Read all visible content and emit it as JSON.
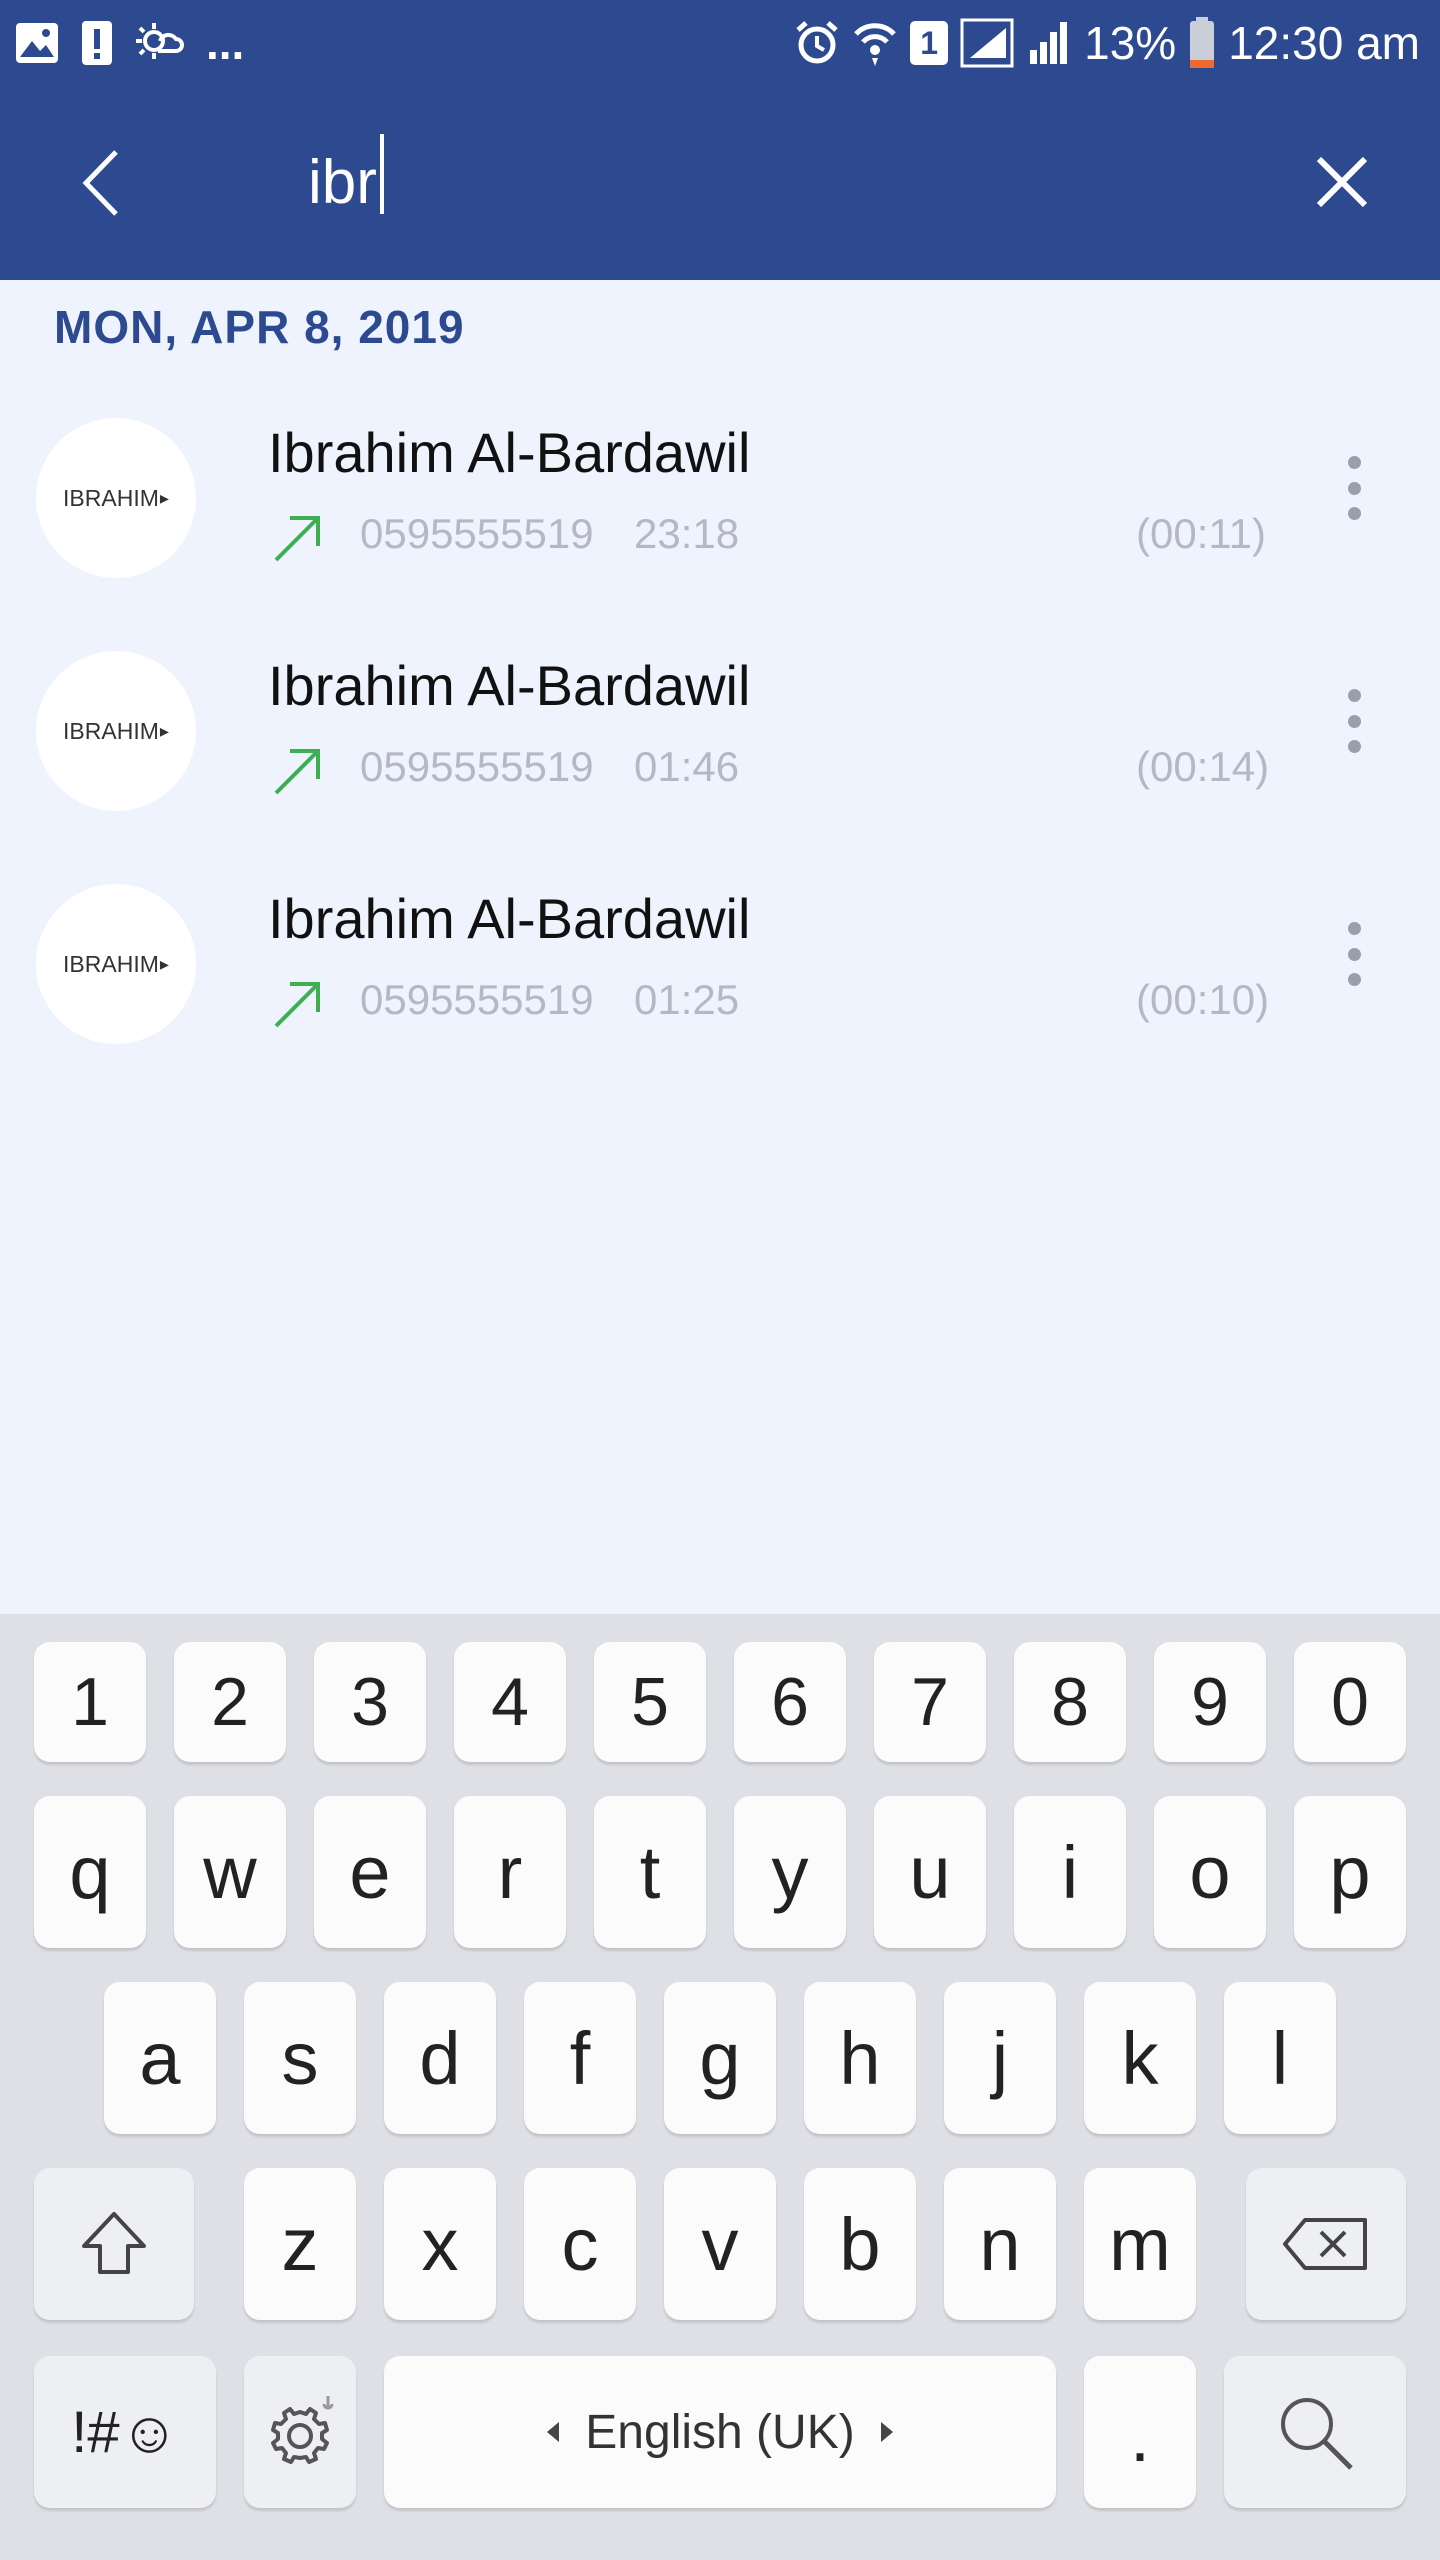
{
  "colors": {
    "primary": "#2d4a91",
    "background": "#eef3fe",
    "outgoing": "#3dae52",
    "muted": "#b5b8c4"
  },
  "status_bar": {
    "battery": "13%",
    "time": "12:30 am",
    "sim": "1",
    "dots": "..."
  },
  "search": {
    "value": "ibr",
    "back_icon": "chevron-left-icon",
    "close_icon": "close-icon"
  },
  "date_header": "MON, APR 8, 2019",
  "calls": [
    {
      "avatar_text": "IBRAHIM",
      "name": "Ibrahim Al-Bardawil",
      "number": "0595555519",
      "time": "23:18",
      "duration": "(00:11)",
      "direction": "outgoing"
    },
    {
      "avatar_text": "IBRAHIM",
      "name": "Ibrahim Al-Bardawil",
      "number": "0595555519",
      "time": "01:46",
      "duration": "(00:14)",
      "direction": "outgoing"
    },
    {
      "avatar_text": "IBRAHIM",
      "name": "Ibrahim Al-Bardawil",
      "number": "0595555519",
      "time": "01:25",
      "duration": "(00:10)",
      "direction": "outgoing"
    }
  ],
  "keyboard": {
    "row_numbers": [
      "1",
      "2",
      "3",
      "4",
      "5",
      "6",
      "7",
      "8",
      "9",
      "0"
    ],
    "row_1": [
      "q",
      "w",
      "e",
      "r",
      "t",
      "y",
      "u",
      "i",
      "o",
      "p"
    ],
    "row_2": [
      "a",
      "s",
      "d",
      "f",
      "g",
      "h",
      "j",
      "k",
      "l"
    ],
    "row_3": [
      "z",
      "x",
      "c",
      "v",
      "b",
      "n",
      "m"
    ],
    "symbols": "!#☺",
    "space": "English (UK)",
    "period": "."
  }
}
